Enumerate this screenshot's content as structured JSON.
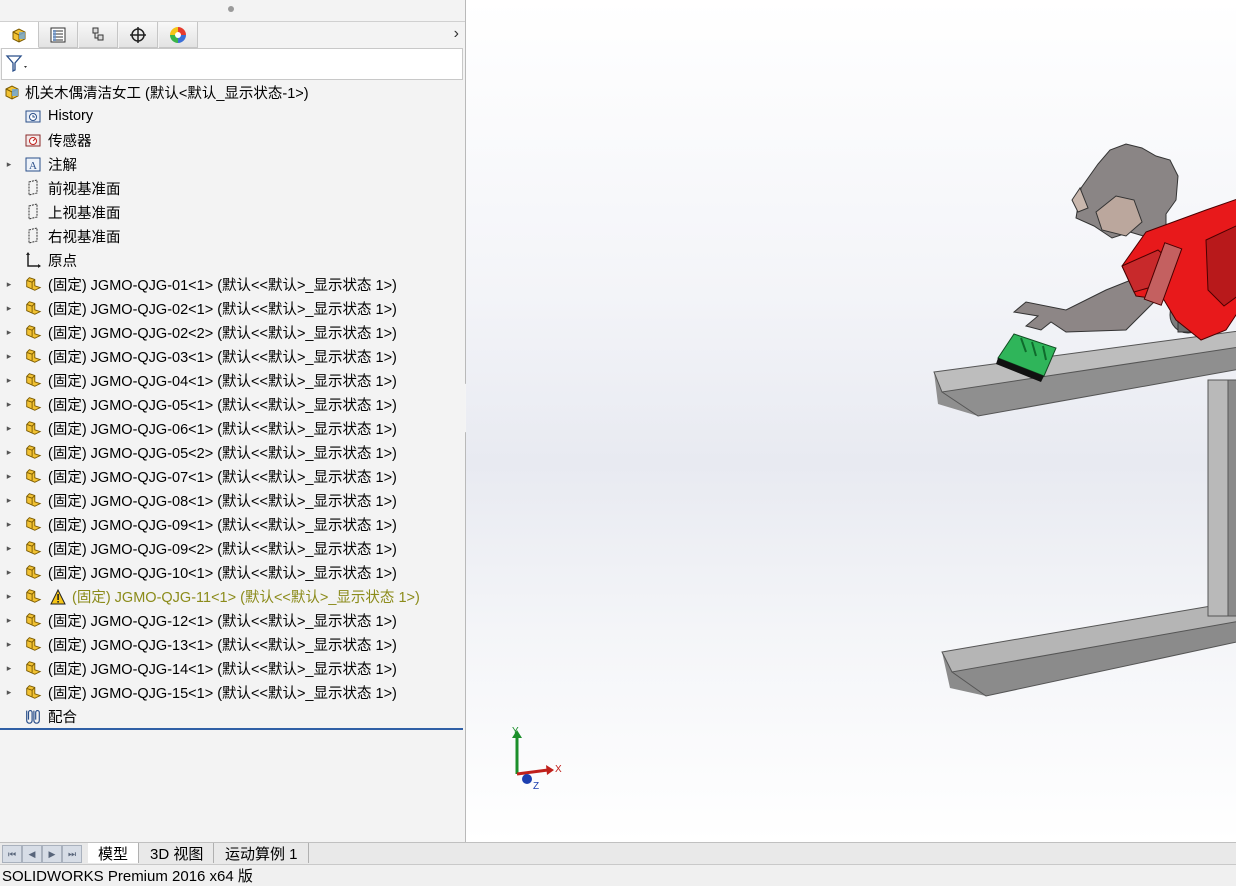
{
  "feature_tree": {
    "tabs": [
      "featuremanager-tab",
      "propertymanager-tab",
      "configurationmanager-tab",
      "dimxpert-tab",
      "display-manager-tab"
    ],
    "filter_icon": "filter-icon",
    "root": {
      "label": "机关木偶清洁女工  (默认<默认_显示状态-1>)"
    },
    "items": [
      {
        "label": "History",
        "icon": "history-folder-icon",
        "expandable": false
      },
      {
        "label": "传感器",
        "icon": "sensors-icon",
        "expandable": false
      },
      {
        "label": "注解",
        "icon": "annotations-icon",
        "expandable": true
      },
      {
        "label": "前视基准面",
        "icon": "plane-icon",
        "expandable": false
      },
      {
        "label": "上视基准面",
        "icon": "plane-icon",
        "expandable": false
      },
      {
        "label": "右视基准面",
        "icon": "plane-icon",
        "expandable": false
      },
      {
        "label": "原点",
        "icon": "origin-icon",
        "expandable": false
      },
      {
        "label": "(固定) JGMO-QJG-01<1> (默认<<默认>_显示状态 1>)",
        "icon": "part-icon",
        "expandable": true
      },
      {
        "label": "(固定) JGMO-QJG-02<1> (默认<<默认>_显示状态 1>)",
        "icon": "part-icon",
        "expandable": true
      },
      {
        "label": "(固定) JGMO-QJG-02<2> (默认<<默认>_显示状态 1>)",
        "icon": "part-icon",
        "expandable": true
      },
      {
        "label": "(固定) JGMO-QJG-03<1> (默认<<默认>_显示状态 1>)",
        "icon": "part-icon",
        "expandable": true
      },
      {
        "label": "(固定) JGMO-QJG-04<1> (默认<<默认>_显示状态 1>)",
        "icon": "part-icon",
        "expandable": true
      },
      {
        "label": "(固定) JGMO-QJG-05<1> (默认<<默认>_显示状态 1>)",
        "icon": "part-icon",
        "expandable": true
      },
      {
        "label": "(固定) JGMO-QJG-06<1> (默认<<默认>_显示状态 1>)",
        "icon": "part-icon",
        "expandable": true
      },
      {
        "label": "(固定) JGMO-QJG-05<2> (默认<<默认>_显示状态 1>)",
        "icon": "part-icon",
        "expandable": true
      },
      {
        "label": "(固定) JGMO-QJG-07<1> (默认<<默认>_显示状态 1>)",
        "icon": "part-icon",
        "expandable": true
      },
      {
        "label": "(固定) JGMO-QJG-08<1> (默认<<默认>_显示状态 1>)",
        "icon": "part-icon",
        "expandable": true
      },
      {
        "label": "(固定) JGMO-QJG-09<1> (默认<<默认>_显示状态 1>)",
        "icon": "part-icon",
        "expandable": true
      },
      {
        "label": "(固定) JGMO-QJG-09<2> (默认<<默认>_显示状态 1>)",
        "icon": "part-icon",
        "expandable": true
      },
      {
        "label": "(固定) JGMO-QJG-10<1> (默认<<默认>_显示状态 1>)",
        "icon": "part-icon",
        "expandable": true
      },
      {
        "label": "(固定) JGMO-QJG-11<1> (默认<<默认>_显示状态 1>)",
        "icon": "part-icon",
        "expandable": true,
        "warning": true
      },
      {
        "label": "(固定) JGMO-QJG-12<1> (默认<<默认>_显示状态 1>)",
        "icon": "part-icon",
        "expandable": true
      },
      {
        "label": "(固定) JGMO-QJG-13<1> (默认<<默认>_显示状态 1>)",
        "icon": "part-icon",
        "expandable": true
      },
      {
        "label": "(固定) JGMO-QJG-14<1> (默认<<默认>_显示状态 1>)",
        "icon": "part-icon",
        "expandable": true
      },
      {
        "label": "(固定) JGMO-QJG-15<1> (默认<<默认>_显示状态 1>)",
        "icon": "part-icon",
        "expandable": true
      },
      {
        "label": "配合",
        "icon": "mates-icon",
        "expandable": false
      }
    ]
  },
  "triad": {
    "x": "X",
    "y": "Y",
    "z": "Z"
  },
  "bottom_tabs": {
    "model": "模型",
    "view3d": "3D 视图",
    "motion": "运动算例 1"
  },
  "status_bar": {
    "text": "SOLIDWORKS Premium 2016 x64 版"
  },
  "colors": {
    "part_body": "#e8191b",
    "part_gray": "#9b9b9b",
    "brush_green": "#2fb55a",
    "tree_separator": "#2f5fa5",
    "warning_text": "#8b8b1a"
  }
}
